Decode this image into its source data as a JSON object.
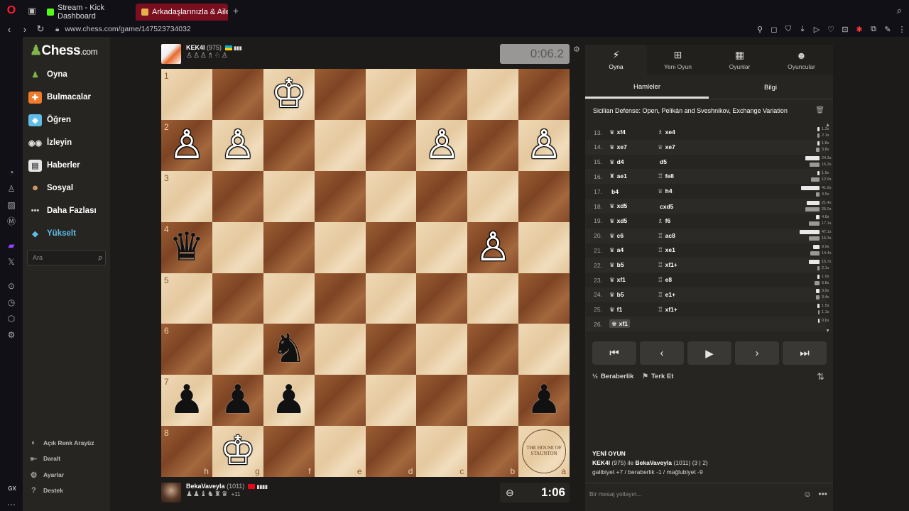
{
  "browser": {
    "tabs": [
      {
        "label": "Stream - Kick Dashboard",
        "color": "#53fc18"
      },
      {
        "label": "Arkadaşlarınızla & Ailenizle",
        "color": "#e7b04e"
      }
    ],
    "url": "www.chess.com/game/147523734032"
  },
  "sidebar": {
    "logo": "Chess",
    "logo_suffix": ".com",
    "items": [
      {
        "label": "Oyna",
        "icon": "pawn-icon",
        "color": "#81b64c"
      },
      {
        "label": "Bulmacalar",
        "icon": "puzzle-icon",
        "color": "#f07b2d"
      },
      {
        "label": "Öğren",
        "icon": "learn-icon",
        "color": "#5fbde7"
      },
      {
        "label": "İzleyin",
        "icon": "binoculars-icon",
        "color": "#d9d9d9"
      },
      {
        "label": "Haberler",
        "icon": "news-icon",
        "color": "#e6e6e6"
      },
      {
        "label": "Sosyal",
        "icon": "social-icon",
        "color": "#e0a36a"
      },
      {
        "label": "Daha Fazlası",
        "icon": "more-icon",
        "color": "#cccccc"
      },
      {
        "label": "Yükselt",
        "icon": "diamond-icon",
        "color": "#5fbde7"
      }
    ],
    "search_placeholder": "Ara",
    "bottom": [
      {
        "label": "Açık Renk Arayüz",
        "icon": "theme-icon"
      },
      {
        "label": "Daralt",
        "icon": "collapse-icon"
      },
      {
        "label": "Ayarlar",
        "icon": "gear-icon"
      },
      {
        "label": "Destek",
        "icon": "help-icon"
      }
    ]
  },
  "top_player": {
    "name": "KEK4I",
    "rating": "(975)",
    "captured": "♙♙♙♗♘♙",
    "clock": "0:06.2"
  },
  "bottom_player": {
    "name": "BekaVaveyla",
    "rating": "(1011)",
    "captured": "♟♟♝♞♜♛",
    "advantage": "+11",
    "clock": "1:06"
  },
  "board": {
    "ranks": [
      "1",
      "2",
      "3",
      "4",
      "5",
      "6",
      "7",
      "8"
    ],
    "files": [
      "h",
      "g",
      "f",
      "e",
      "d",
      "c",
      "b",
      "a"
    ],
    "squares": [
      [
        "",
        "",
        "♔w",
        "",
        "",
        "",
        "",
        ""
      ],
      [
        "♙w",
        "♙w",
        "",
        "",
        "",
        "♙w",
        "",
        "♙w"
      ],
      [
        "",
        "",
        "",
        "",
        "",
        "",
        "",
        ""
      ],
      [
        "♛b",
        "",
        "",
        "",
        "",
        "",
        "♙w",
        ""
      ],
      [
        "",
        "",
        "",
        "",
        "",
        "",
        "",
        ""
      ],
      [
        "",
        "",
        "♞b",
        "",
        "",
        "",
        "",
        ""
      ],
      [
        "♟b",
        "♟b",
        "♟b",
        "",
        "",
        "",
        "",
        "♟b"
      ],
      [
        "",
        "♔w",
        "",
        "",
        "",
        "",
        "",
        ""
      ]
    ],
    "watermark": "THE HOUSE OF STAUNTON"
  },
  "panel": {
    "tabs": [
      {
        "label": "Oyna",
        "icon": "bolt-icon"
      },
      {
        "label": "Yeni Oyun",
        "icon": "plus-icon"
      },
      {
        "label": "Oyunlar",
        "icon": "board-icon"
      },
      {
        "label": "Oyuncular",
        "icon": "players-icon"
      }
    ],
    "subtabs": [
      "Hamleler",
      "Bilgi"
    ],
    "opening": "Sicilian Defense: Open, Pelikán and Sveshnikov, Exchange Variation",
    "moves": [
      {
        "n": "13.",
        "w": "xf4",
        "wp": "♛",
        "b": "xe4",
        "bp": "♗",
        "tw": "1.2s",
        "tb": "2.1s",
        "lw": 3,
        "lb": 3
      },
      {
        "n": "14.",
        "w": "xe7",
        "wp": "♛",
        "b": "xe7",
        "bp": "♕",
        "tw": "1.8s",
        "tb": "3.8s",
        "lw": 3,
        "lb": 5
      },
      {
        "n": "15.",
        "w": "d4",
        "wp": "♛",
        "b": "d5",
        "bp": "",
        "tw": "24.3s",
        "tb": "15.2s",
        "lw": 20,
        "lb": 14
      },
      {
        "n": "16.",
        "w": "ae1",
        "wp": "♜",
        "b": "fe8",
        "bp": "♖",
        "tw": "1.9s",
        "tb": "12.9s",
        "lw": 3,
        "lb": 12
      },
      {
        "n": "17.",
        "w": "b4",
        "wp": "",
        "b": "h4",
        "bp": "♕",
        "tw": "41.6s",
        "tb": "3.5s",
        "lw": 26,
        "lb": 5
      },
      {
        "n": "18.",
        "w": "xd5",
        "wp": "♛",
        "b": "cxd5",
        "bp": "",
        "tw": "21.4s",
        "tb": "25.0s",
        "lw": 18,
        "lb": 20
      },
      {
        "n": "19.",
        "w": "xd5",
        "wp": "♛",
        "b": "f6",
        "bp": "♗",
        "tw": "4.8s",
        "tb": "17.1s",
        "lw": 5,
        "lb": 15
      },
      {
        "n": "20.",
        "w": "c6",
        "wp": "♛",
        "b": "ac8",
        "bp": "♖",
        "tw": "47.1s",
        "tb": "16.3s",
        "lw": 28,
        "lb": 15
      },
      {
        "n": "21.",
        "w": "a4",
        "wp": "♛",
        "b": "xe1",
        "bp": "♖",
        "tw": "8.9s",
        "tb": "14.4s",
        "lw": 9,
        "lb": 13
      },
      {
        "n": "22.",
        "w": "b5",
        "wp": "♛",
        "b": "xf1+",
        "bp": "♖",
        "tw": "15.7s",
        "tb": "2.1s",
        "lw": 15,
        "lb": 3
      },
      {
        "n": "23.",
        "w": "xf1",
        "wp": "♛",
        "b": "e8",
        "bp": "♖",
        "tw": "1.9s",
        "tb": "6.8s",
        "lw": 3,
        "lb": 7
      },
      {
        "n": "24.",
        "w": "b5",
        "wp": "♛",
        "b": "e1+",
        "bp": "♖",
        "tw": "3.9s",
        "tb": "3.4s",
        "lw": 5,
        "lb": 5
      },
      {
        "n": "25.",
        "w": "f1",
        "wp": "♛",
        "b": "xf1+",
        "bp": "♖",
        "tw": "1.5s",
        "tb": "1.1s",
        "lw": 3,
        "lb": 2
      },
      {
        "n": "26.",
        "w": "xf1",
        "wp": "♚",
        "b": "",
        "bp": "",
        "tw": "0.6s",
        "tb": "",
        "lw": 2,
        "lb": 0
      }
    ],
    "draw_label": "Beraberlik",
    "resign_label": "Terk Et",
    "draw_icon": "½",
    "new_game": {
      "title": "YENİ OYUN",
      "line1_w": "KEK4I",
      "line1_wr": "(975)",
      "line1_mid": " ile ",
      "line1_b": "BekaVaveyla",
      "line1_br": "(1011) (3 | 2)",
      "line2": "galibiyet +7 / beraberlik -1 / mağlubiyet -9"
    },
    "chat_placeholder": "Bir mesaj yollayın..."
  }
}
